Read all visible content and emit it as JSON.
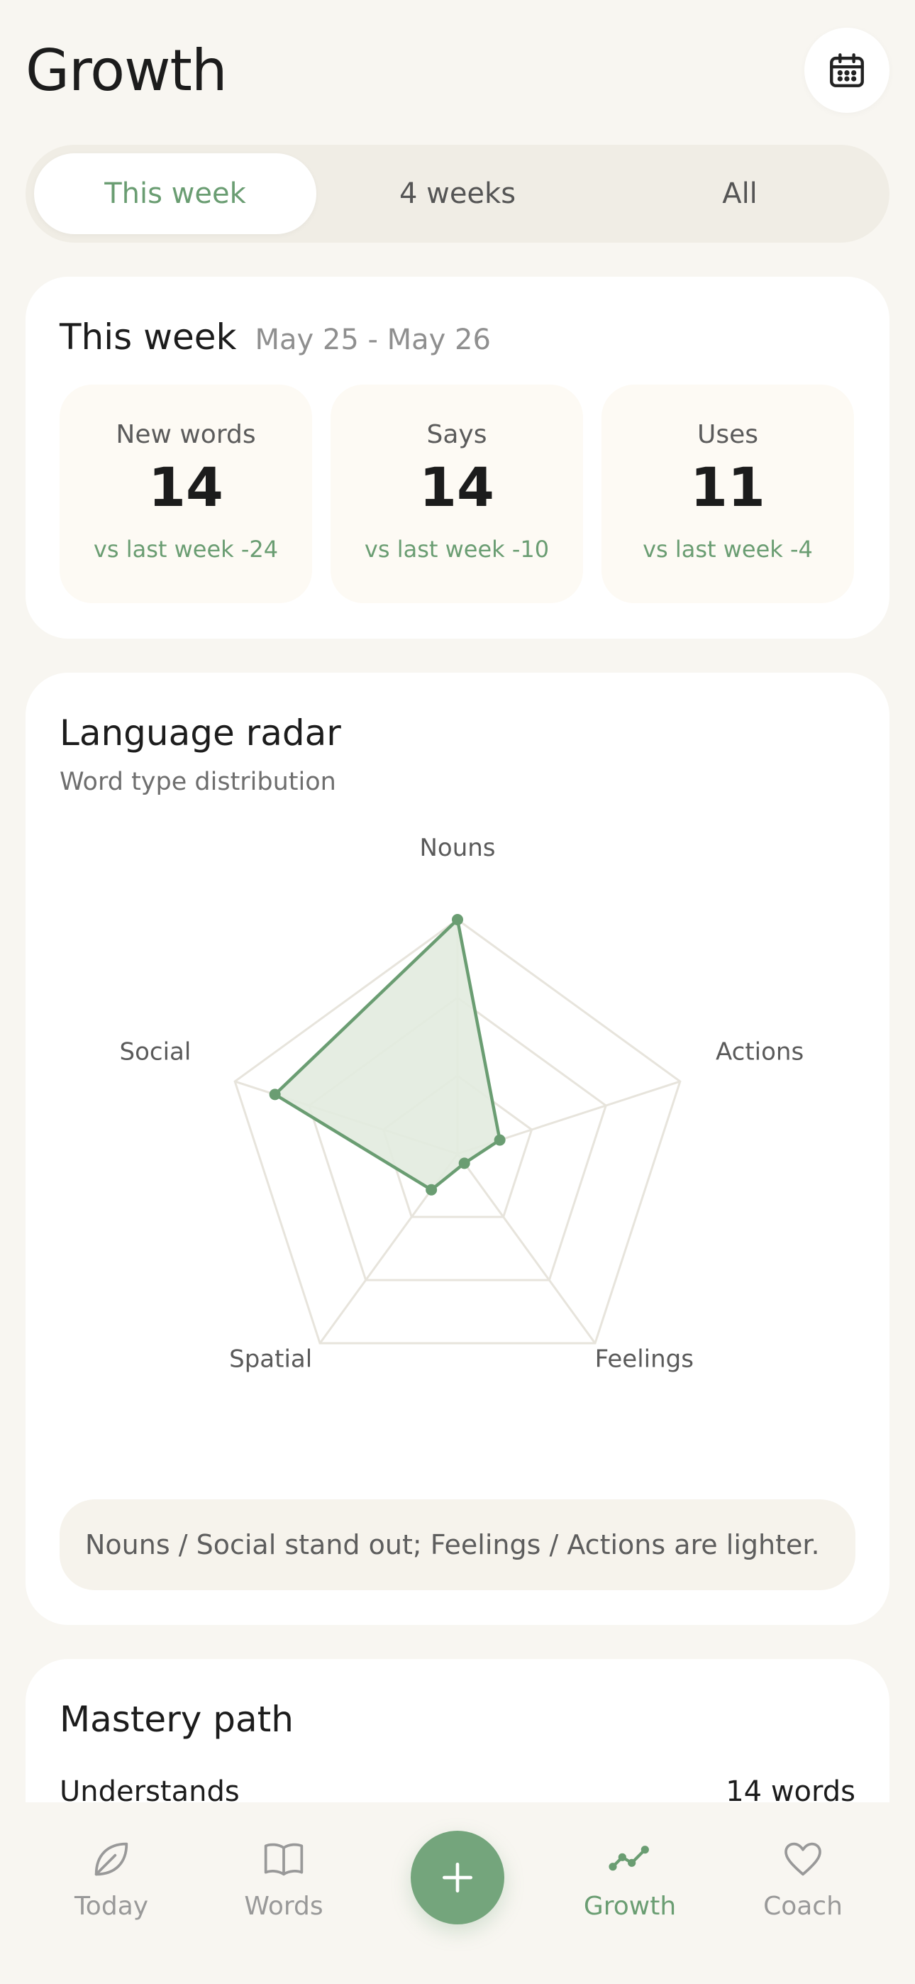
{
  "header": {
    "title": "Growth",
    "calendar_icon": "calendar-icon"
  },
  "range_tabs": [
    {
      "label": "This week",
      "active": true
    },
    {
      "label": "4 weeks",
      "active": false
    },
    {
      "label": "All",
      "active": false
    }
  ],
  "week_card": {
    "title": "This week",
    "date_range": "May 25 - May 26",
    "stats": [
      {
        "label": "New words",
        "value": "14",
        "delta": "vs last week -24"
      },
      {
        "label": "Says",
        "value": "14",
        "delta": "vs last week -10"
      },
      {
        "label": "Uses",
        "value": "11",
        "delta": "vs last week -4"
      }
    ]
  },
  "radar_card": {
    "title": "Language radar",
    "subtitle": "Word type distribution",
    "insight": "Nouns / Social stand out; Feelings / Actions are lighter."
  },
  "chart_data": {
    "type": "radar",
    "categories": [
      "Nouns",
      "Actions",
      "Feelings",
      "Spatial",
      "Social"
    ],
    "values": [
      1.0,
      0.19,
      0.0,
      0.19,
      0.82
    ],
    "max": 1.0,
    "rings": 3,
    "color": "#6a9d72",
    "fill": "#e2ebdf"
  },
  "mastery_card": {
    "title": "Mastery path",
    "row_label": "Understands",
    "row_value": "14 words"
  },
  "tabbar": {
    "items": [
      {
        "label": "Today",
        "icon": "leaf-icon",
        "active": false
      },
      {
        "label": "Words",
        "icon": "book-icon",
        "active": false
      },
      {
        "label": "Growth",
        "icon": "trend-line-icon",
        "active": true
      },
      {
        "label": "Coach",
        "icon": "heart-icon",
        "active": false
      }
    ],
    "fab_icon": "plus-icon"
  },
  "colors": {
    "accent": "#6a9d72",
    "background": "#f8f6f1",
    "card": "#ffffff"
  }
}
